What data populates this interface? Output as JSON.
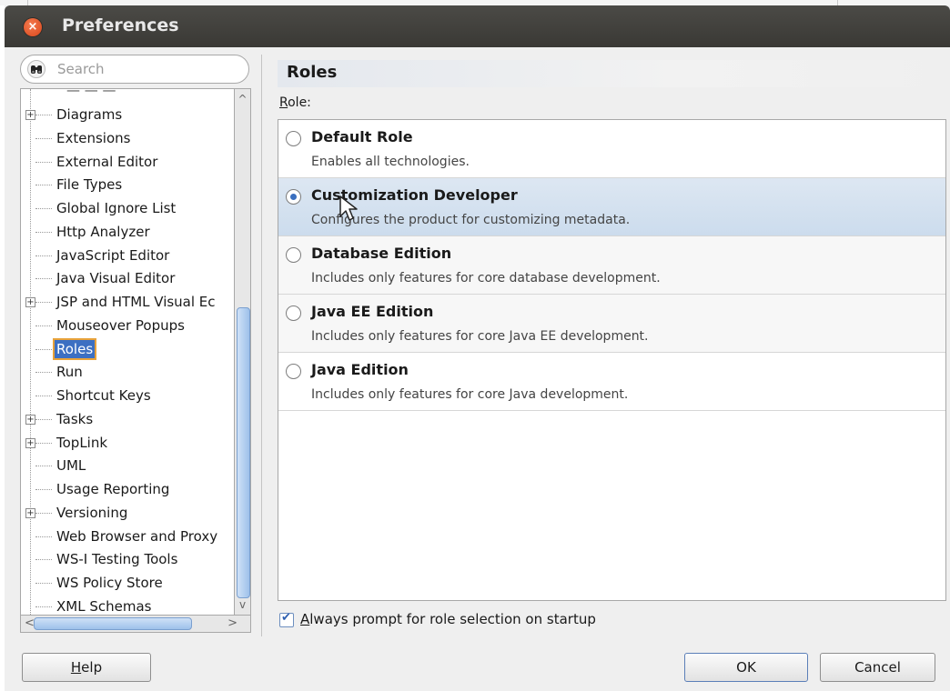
{
  "window": {
    "title": "Preferences"
  },
  "search": {
    "placeholder": "Search"
  },
  "tree": {
    "items": [
      {
        "label": "Diagrams",
        "expandable": true
      },
      {
        "label": "Extensions",
        "expandable": false
      },
      {
        "label": "External Editor",
        "expandable": false
      },
      {
        "label": "File Types",
        "expandable": false
      },
      {
        "label": "Global Ignore List",
        "expandable": false
      },
      {
        "label": "Http Analyzer",
        "expandable": false
      },
      {
        "label": "JavaScript Editor",
        "expandable": false
      },
      {
        "label": "Java Visual Editor",
        "expandable": false
      },
      {
        "label": "JSP and HTML Visual Ec",
        "expandable": true
      },
      {
        "label": "Mouseover Popups",
        "expandable": false
      },
      {
        "label": "Roles",
        "expandable": false,
        "selected": true
      },
      {
        "label": "Run",
        "expandable": false
      },
      {
        "label": "Shortcut Keys",
        "expandable": false
      },
      {
        "label": "Tasks",
        "expandable": true
      },
      {
        "label": "TopLink",
        "expandable": true
      },
      {
        "label": "UML",
        "expandable": false
      },
      {
        "label": "Usage Reporting",
        "expandable": false
      },
      {
        "label": "Versioning",
        "expandable": true
      },
      {
        "label": "Web Browser and Proxy",
        "expandable": false
      },
      {
        "label": "WS-I Testing Tools",
        "expandable": false
      },
      {
        "label": "WS Policy Store",
        "expandable": false
      },
      {
        "label": "XML Schemas",
        "expandable": false
      }
    ]
  },
  "panel": {
    "header": "Roles",
    "role_label_mnemonic": "R",
    "role_label_rest": "ole:",
    "roles": [
      {
        "title": "Default Role",
        "description": "Enables all technologies.",
        "selected": false
      },
      {
        "title": "Customization Developer",
        "description": "Configures the product for customizing metadata.",
        "selected": true
      },
      {
        "title": "Database Edition",
        "description": "Includes only features for core database development.",
        "selected": false
      },
      {
        "title": "Java EE Edition",
        "description": "Includes only features for core Java EE development.",
        "selected": false
      },
      {
        "title": "Java Edition",
        "description": "Includes only features for core Java development.",
        "selected": false
      }
    ],
    "always_prompt": {
      "mnemonic": "A",
      "rest": "lways prompt for role selection on startup",
      "checked": true
    }
  },
  "buttons": {
    "help_mnemonic": "H",
    "help_rest": "elp",
    "ok": "OK",
    "cancel": "Cancel"
  },
  "colors": {
    "titlebar": "#3a3935",
    "selection": "#3c6fc2",
    "selected_row": "#ccdced",
    "close_button": "#d9471c"
  }
}
